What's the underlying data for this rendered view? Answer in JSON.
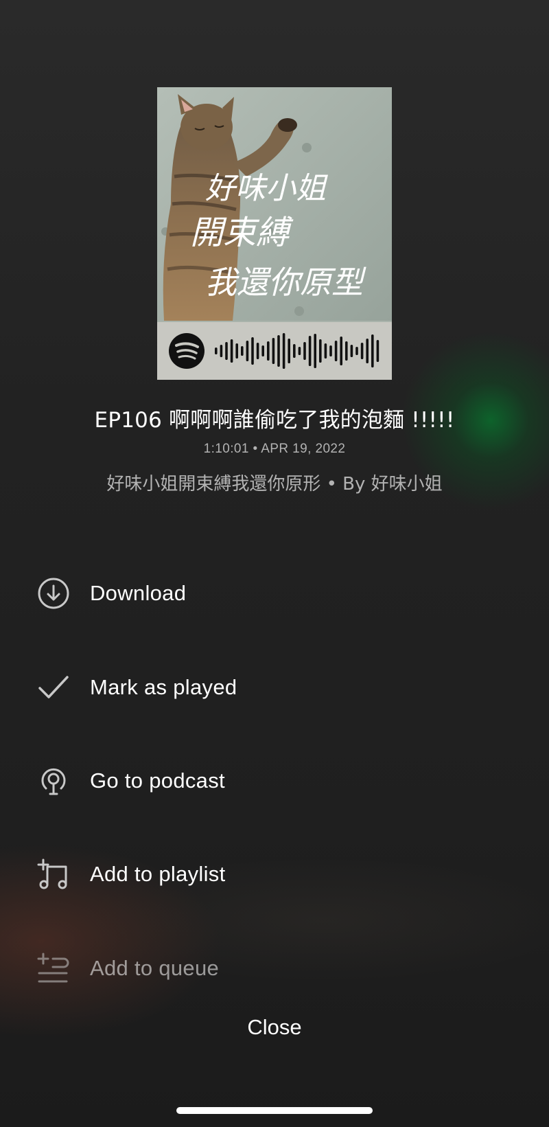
{
  "episode": {
    "title": "EP106 啊啊啊誰偷吃了我的泡麵 !!!!!",
    "duration": "1:10:01",
    "date": "APR 19, 2022",
    "separator": "•",
    "show_line": "好味小姐開束縛我還你原形 • By 好味小姐"
  },
  "cover": {
    "overlay_text_line1": "好味小姐",
    "overlay_text_line2": "開束縛",
    "overlay_text_line3": "我還你原型",
    "icon": "spotify-logo-icon"
  },
  "menu": [
    {
      "label": "Download",
      "icon": "download-circle-icon"
    },
    {
      "label": "Mark as played",
      "icon": "check-icon"
    },
    {
      "label": "Go to podcast",
      "icon": "podcast-icon"
    },
    {
      "label": "Add to playlist",
      "icon": "add-to-playlist-icon"
    },
    {
      "label": "Add to queue",
      "icon": "add-to-queue-icon"
    }
  ],
  "close_label": "Close",
  "colors": {
    "background": "#1e1e1e",
    "text": "#ffffff",
    "muted_text": "#b3b3b3",
    "accent_glow": "#0a6e2d"
  }
}
